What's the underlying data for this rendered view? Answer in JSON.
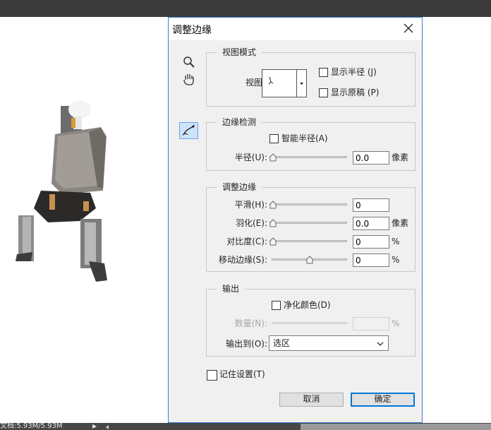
{
  "status_bar": {
    "doc_info": "文档:5.93M/5.93M"
  },
  "dialog": {
    "title": "调整边缘",
    "view_mode": {
      "legend": "视图模式",
      "view_label": "视图:",
      "show_radius": "显示半径 (J)",
      "show_original": "显示原稿 (P)",
      "show_radius_checked": false,
      "show_original_checked": false
    },
    "edge_detection": {
      "legend": "边缘检测",
      "smart_radius": "智能半径(A)",
      "smart_radius_checked": false,
      "radius_label": "半径(U):",
      "radius_value": "0.0",
      "radius_unit": "像素",
      "radius_level": 0
    },
    "adjust_edge": {
      "legend": "调整边缘",
      "smooth_label": "平滑(H):",
      "smooth_value": "0",
      "smooth_level": 0,
      "feather_label": "羽化(E):",
      "feather_value": "0.0",
      "feather_unit": "像素",
      "feather_level": 0,
      "contrast_label": "对比度(C):",
      "contrast_value": "0",
      "contrast_unit": "%",
      "contrast_level": 0,
      "shift_label": "移动边缘(S):",
      "shift_value": "0",
      "shift_unit": "%",
      "shift_level": 0.5
    },
    "output": {
      "legend": "输出",
      "decontaminate": "净化颜色(D)",
      "decontaminate_checked": false,
      "amount_label": "数量(N):",
      "amount_value": "",
      "amount_unit": "%",
      "output_to_label": "输出到(O):",
      "output_to_value": "选区"
    },
    "remember": "记住设置(T)",
    "remember_checked": false,
    "cancel": "取消",
    "ok": "确定"
  },
  "icons": {
    "zoom": "magnifier-icon",
    "hand": "hand-icon",
    "refine_brush": "refine-radius-brush-icon",
    "close": "close-icon"
  },
  "colors": {
    "dialog_border": "#3a7ad4",
    "accent": "#0078d7",
    "tool_active": "#cde3fb"
  }
}
